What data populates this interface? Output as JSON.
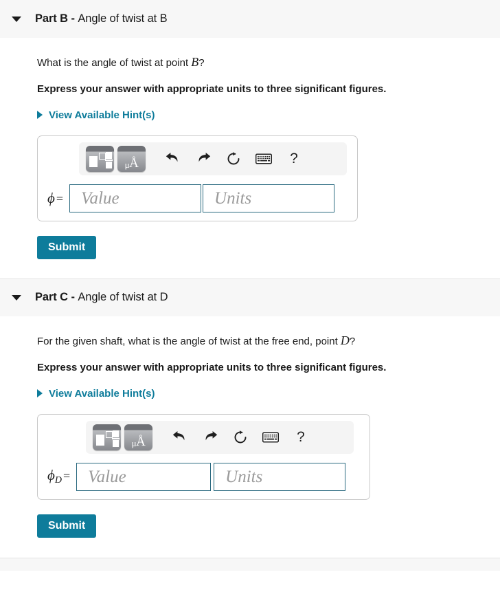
{
  "parts": [
    {
      "id": "part-b",
      "label": "Part B",
      "dash": " - ",
      "subtitle": "Angle of twist at B",
      "question_prefix": "What is the angle of twist at point ",
      "question_var": "B",
      "question_suffix": "?",
      "instruction": "Express your answer with appropriate units to three significant figures.",
      "hint_link": "View Available Hint(s)",
      "answer_label_symbol": "ϕ",
      "answer_label_subscript": "",
      "answer_label_equals": "=",
      "value_placeholder": "Value",
      "units_placeholder": "Units",
      "value_current": "",
      "units_current": "",
      "submit_label": "Submit"
    },
    {
      "id": "part-c",
      "label": "Part C",
      "dash": " - ",
      "subtitle": "Angle of twist at D",
      "question_prefix": "For the given shaft, what is the angle of twist at the free end, point ",
      "question_var": "D",
      "question_suffix": "?",
      "instruction": "Express your answer with appropriate units to three significant figures.",
      "hint_link": "View Available Hint(s)",
      "answer_label_symbol": "ϕ",
      "answer_label_subscript": "D",
      "answer_label_equals": "=",
      "value_placeholder": "Value",
      "units_placeholder": "Units",
      "value_current": "",
      "units_current": "",
      "submit_label": "Submit"
    }
  ],
  "toolbar": {
    "template_button_title": "math-template",
    "units_button_label_mu": "μ",
    "units_button_label_a": "Å",
    "undo_label": "undo",
    "redo_label": "redo",
    "reset_label": "reset",
    "keyboard_label": "keyboard",
    "help_label": "?"
  },
  "colors": {
    "accent": "#0e7c9b",
    "header_bg": "#f7f7f7",
    "input_border": "#29697f",
    "box_border": "#c9c9c9",
    "placeholder": "#9a9a9a"
  }
}
